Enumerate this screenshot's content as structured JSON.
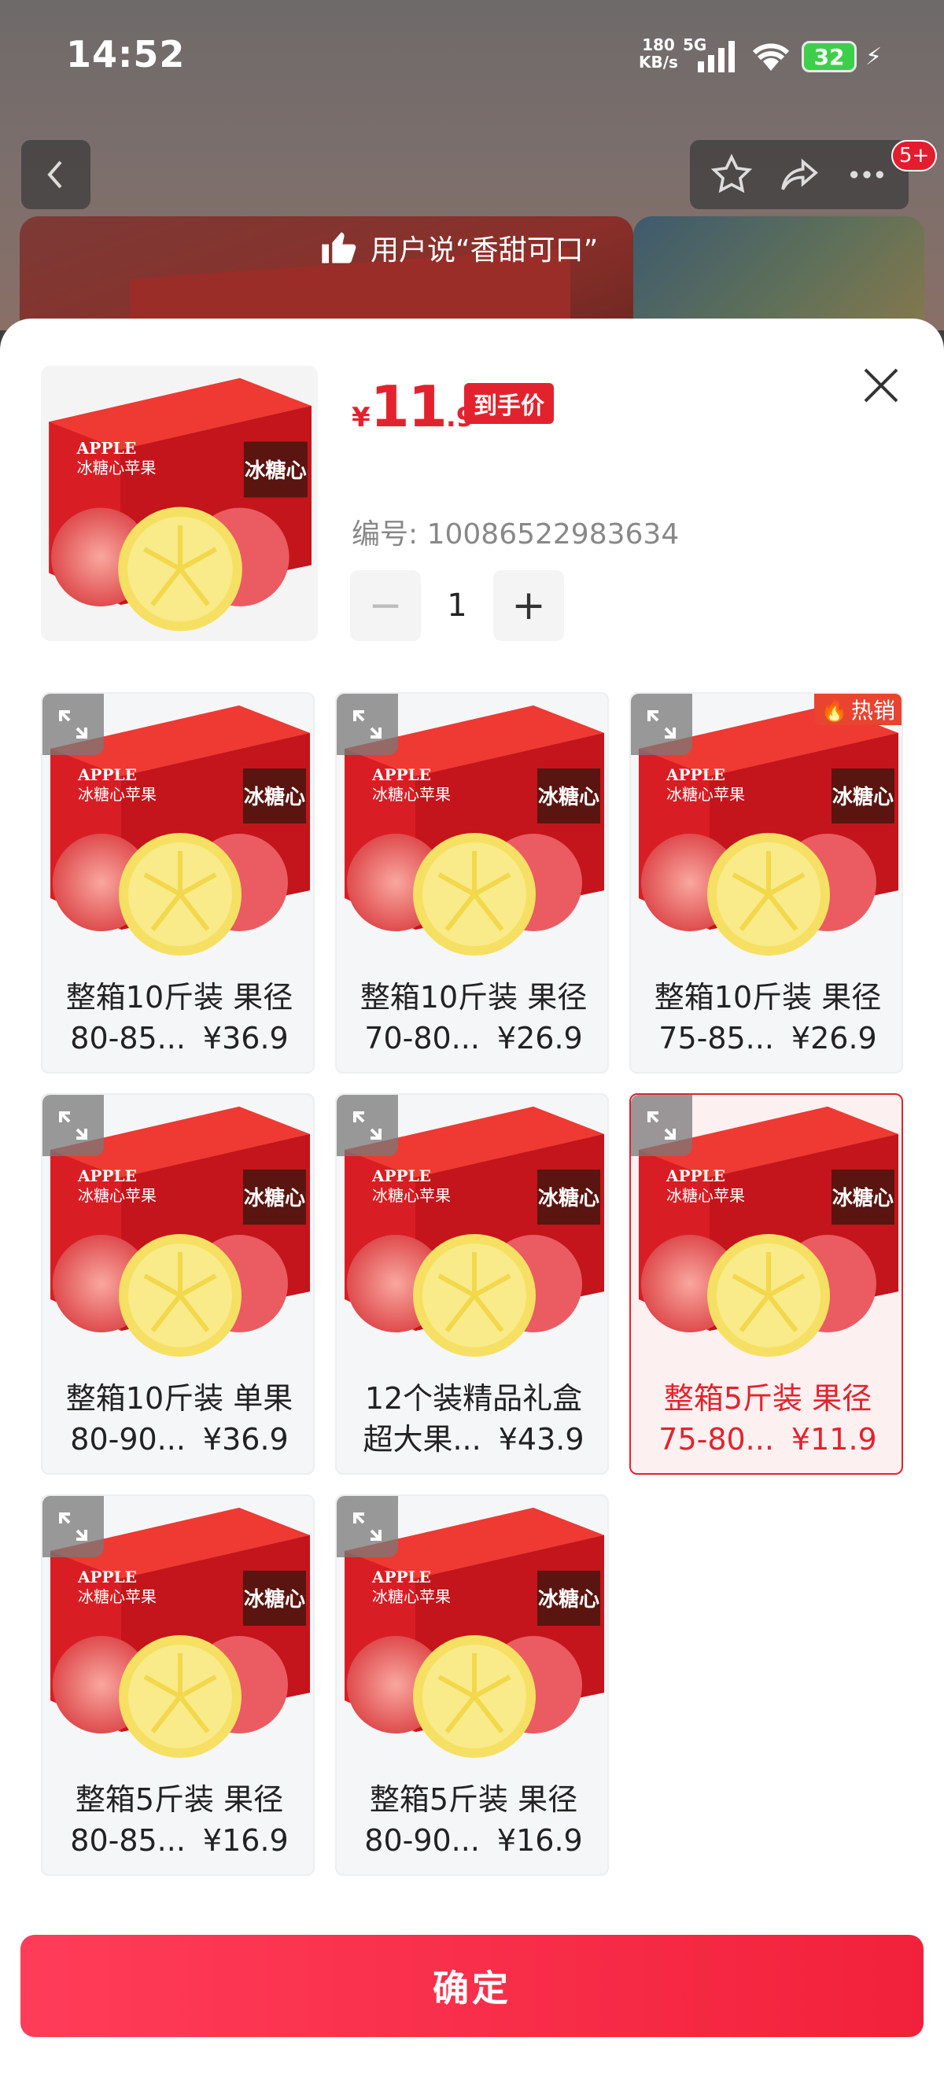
{
  "status_bar": {
    "time": "14:52",
    "net_speed_top": "180",
    "net_speed_bottom": "KB/s",
    "network": "5G",
    "battery": "32"
  },
  "background": {
    "banner_text": "用户说“香甜可口”"
  },
  "nav": {
    "badge": "5+"
  },
  "sku_panel": {
    "price": {
      "currency": "¥",
      "integer": "11",
      "decimal": ".9",
      "tag": "到手价"
    },
    "sku_id": "编号: 10086522983634",
    "quantity": {
      "minus": "−",
      "value": "1",
      "plus": "+"
    },
    "hot_tag": "热销",
    "options": [
      {
        "line1": "整箱10斤装 果径",
        "line2_text": "80-85...",
        "price": "¥36.9",
        "selected": false,
        "hot": false
      },
      {
        "line1": "整箱10斤装 果径",
        "line2_text": "70-80...",
        "price": "¥26.9",
        "selected": false,
        "hot": false
      },
      {
        "line1": "整箱10斤装 果径",
        "line2_text": "75-85...",
        "price": "¥26.9",
        "selected": false,
        "hot": true
      },
      {
        "line1": "整箱10斤装 单果",
        "line2_text": "80-90...",
        "price": "¥36.9",
        "selected": false,
        "hot": false
      },
      {
        "line1": "12个装精品礼盒",
        "line2_text": "超大果...",
        "price": "¥43.9",
        "selected": false,
        "hot": false
      },
      {
        "line1": "整箱5斤装 果径",
        "line2_text": "75-80...",
        "price": "¥11.9",
        "selected": true,
        "hot": false
      },
      {
        "line1": "整箱5斤装 果径",
        "line2_text": "80-85...",
        "price": "¥16.9",
        "selected": false,
        "hot": false
      },
      {
        "line1": "整箱5斤装 果径",
        "line2_text": "80-90...",
        "price": "¥16.9",
        "selected": false,
        "hot": false
      }
    ],
    "product_image": {
      "brand_text": "APPLE",
      "name_text": "冰糖心苹果",
      "badge_text": "冰糖心"
    },
    "confirm_label": "确定"
  },
  "colors": {
    "accent": "#e2232e",
    "confirm_start": "#ff3c59",
    "confirm_end": "#f2213b"
  }
}
